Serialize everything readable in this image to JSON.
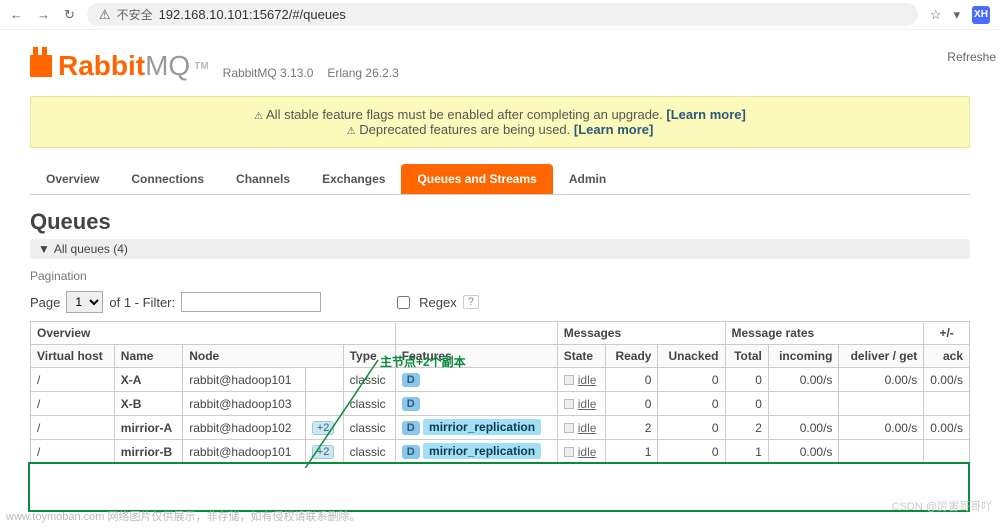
{
  "browser": {
    "url": "192.168.10.101:15672/#/queues",
    "insecure_label": "不安全"
  },
  "top_right": {
    "refresh_label": "Refreshe"
  },
  "logo": {
    "text1": "Rabbit",
    "text2": "MQ",
    "tm": "TM"
  },
  "version": {
    "rabbitmq": "RabbitMQ 3.13.0",
    "erlang": "Erlang 26.2.3"
  },
  "alerts": {
    "line1_prefix": "All stable feature flags must be enabled after completing an upgrade.",
    "line2_prefix": "Deprecated features are being used.",
    "learn_more": "[Learn more]"
  },
  "tabs": [
    "Overview",
    "Connections",
    "Channels",
    "Exchanges",
    "Queues and Streams",
    "Admin"
  ],
  "page": {
    "title": "Queues",
    "section": "All queues (4)",
    "pagination_label": "Pagination",
    "page_label": "Page",
    "page_value": "1",
    "of_label": "of 1  - Filter:",
    "regex_label": "Regex",
    "help": "?",
    "annotation": "主节点+2个副本"
  },
  "table": {
    "group_headers": [
      "Overview",
      "",
      "Messages",
      "Message rates",
      "+/-"
    ],
    "headers": [
      "Virtual host",
      "Name",
      "Node",
      "Type",
      "Features",
      "State",
      "Ready",
      "Unacked",
      "Total",
      "incoming",
      "deliver / get",
      "ack"
    ],
    "rows": [
      {
        "vhost": "/",
        "name": "X-A",
        "node": "rabbit@hadoop101",
        "plus": "",
        "type": "classic",
        "feat_d": "D",
        "feat_tag": "",
        "state": "idle",
        "ready": "0",
        "unacked": "0",
        "total": "0",
        "incoming": "0.00/s",
        "deliver": "0.00/s",
        "ack": "0.00/s"
      },
      {
        "vhost": "/",
        "name": "X-B",
        "node": "rabbit@hadoop103",
        "plus": "",
        "type": "classic",
        "feat_d": "D",
        "feat_tag": "",
        "state": "idle",
        "ready": "0",
        "unacked": "0",
        "total": "0",
        "incoming": "",
        "deliver": "",
        "ack": ""
      },
      {
        "vhost": "/",
        "name": "mirrior-A",
        "node": "rabbit@hadoop102",
        "plus": "+2",
        "type": "classic",
        "feat_d": "D",
        "feat_tag": "mirrior_replication",
        "state": "idle",
        "ready": "2",
        "unacked": "0",
        "total": "2",
        "incoming": "0.00/s",
        "deliver": "0.00/s",
        "ack": "0.00/s"
      },
      {
        "vhost": "/",
        "name": "mirrior-B",
        "node": "rabbit@hadoop101",
        "plus": "+2",
        "type": "classic",
        "feat_d": "D",
        "feat_tag": "mirrior_replication",
        "state": "idle",
        "ready": "1",
        "unacked": "0",
        "total": "1",
        "incoming": "0.00/s",
        "deliver": "",
        "ack": ""
      }
    ]
  },
  "watermark": "www.toymoban.com 网络图片仅供展示，非存储，如有侵权请联系删除。",
  "watermark2": "CSDN @厉害哥哥吖"
}
